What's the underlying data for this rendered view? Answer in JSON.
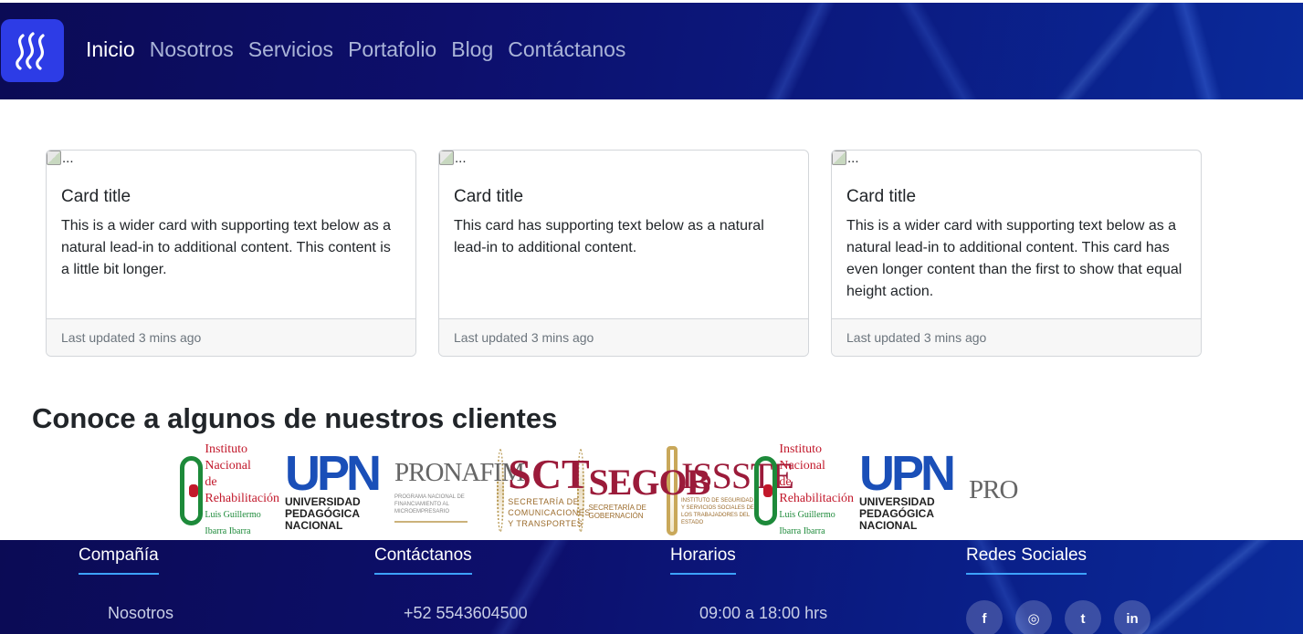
{
  "nav": {
    "brand_icon": "steem-logo-icon",
    "links": [
      "Inicio",
      "Nosotros",
      "Servicios",
      "Portafolio",
      "Blog",
      "Contáctanos"
    ]
  },
  "cards": [
    {
      "img_alt": "...",
      "title": "Card title",
      "text": "This is a wider card with supporting text below as a natural lead-in to additional content. This content is a little bit longer.",
      "footer": "Last updated 3 mins ago"
    },
    {
      "img_alt": "...",
      "title": "Card title",
      "text": "This card has supporting text below as a natural lead-in to additional content.",
      "footer": "Last updated 3 mins ago"
    },
    {
      "img_alt": "...",
      "title": "Card title",
      "text": "This is a wider card with supporting text below as a natural lead-in to additional content. This card has even longer content than the first to show that equal height action.",
      "footer": "Last updated 3 mins ago"
    }
  ],
  "clients": {
    "heading": "Conoce a algunos de nuestros clientes",
    "logos": {
      "inr": {
        "l1": "Instituto Nacional",
        "l2": "de Rehabilitación",
        "l3": "Luis Guillermo Ibarra Ibarra"
      },
      "upn": {
        "mark": "UPN",
        "l1": "UNIVERSIDAD",
        "l2": "PEDAGÓGICA",
        "l3": "NACIONAL"
      },
      "pronafim": {
        "title": "PRONAFIM",
        "sub": "PROGRAMA NACIONAL DE FINANCIAMIENTO AL MICROEMPRESARIO"
      },
      "sct": {
        "title": "SCT",
        "l1": "SECRETARÍA DE",
        "l2": "COMUNICACIONES",
        "l3": "Y TRANSPORTES"
      },
      "segob": {
        "title": "SEGOB",
        "sub": "SECRETARÍA DE GOBERNACIÓN"
      },
      "issste": {
        "title": "ISSSTE",
        "sub": "INSTITUTO DE SEGURIDAD Y SERVICIOS SOCIALES DE LOS TRABAJADORES DEL ESTADO"
      },
      "pronafim_partial": "PRO"
    }
  },
  "footer": {
    "company": {
      "title": "Compañía",
      "item": "Nosotros"
    },
    "contact": {
      "title": "Contáctanos",
      "item": "+52 5543604500"
    },
    "hours": {
      "title": "Horarios",
      "item": "09:00 a 18:00 hrs"
    },
    "social": {
      "title": "Redes Sociales",
      "icons": [
        "f",
        "◎",
        "t",
        "in"
      ]
    }
  },
  "colors": {
    "nav_bg": "#0d0f6c",
    "brand_bg": "#2d3ce6",
    "accent_underline": "#3da2ff"
  }
}
